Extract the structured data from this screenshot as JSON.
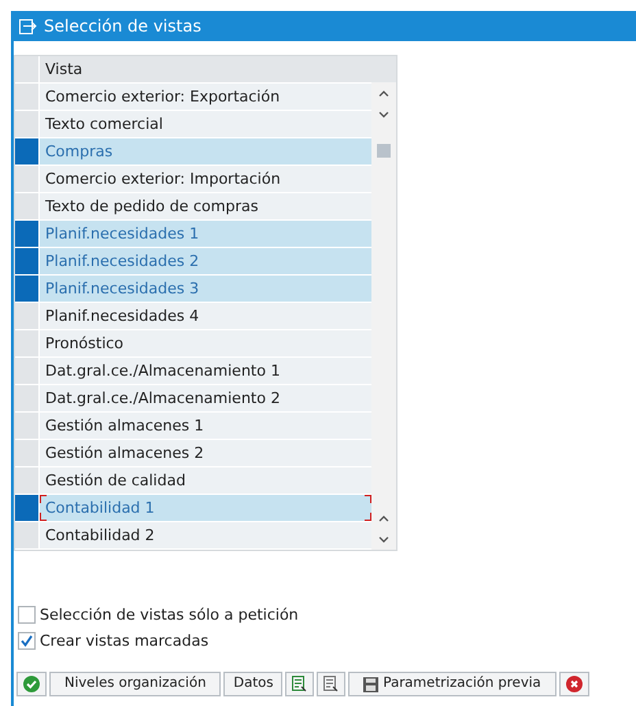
{
  "window": {
    "title": "Selección de vistas"
  },
  "table": {
    "columns": [
      "Vista"
    ],
    "rows": [
      {
        "label": "Comercio exterior: Exportación",
        "selected": false,
        "focused": false
      },
      {
        "label": "Texto comercial",
        "selected": false,
        "focused": false
      },
      {
        "label": "Compras",
        "selected": true,
        "focused": false
      },
      {
        "label": "Comercio exterior: Importación",
        "selected": false,
        "focused": false
      },
      {
        "label": "Texto de pedido de compras",
        "selected": false,
        "focused": false
      },
      {
        "label": "Planif.necesidades 1",
        "selected": true,
        "focused": false
      },
      {
        "label": "Planif.necesidades 2",
        "selected": true,
        "focused": false
      },
      {
        "label": "Planif.necesidades 3",
        "selected": true,
        "focused": false
      },
      {
        "label": "Planif.necesidades 4",
        "selected": false,
        "focused": false
      },
      {
        "label": "Pronóstico",
        "selected": false,
        "focused": false
      },
      {
        "label": "Dat.gral.ce./Almacenamiento 1",
        "selected": false,
        "focused": false
      },
      {
        "label": "Dat.gral.ce./Almacenamiento 2",
        "selected": false,
        "focused": false
      },
      {
        "label": "Gestión almacenes 1",
        "selected": false,
        "focused": false
      },
      {
        "label": "Gestión almacenes 2",
        "selected": false,
        "focused": false
      },
      {
        "label": "Gestión de calidad",
        "selected": false,
        "focused": false
      },
      {
        "label": "Contabilidad 1",
        "selected": true,
        "focused": true
      },
      {
        "label": "Contabilidad 2",
        "selected": false,
        "focused": false
      }
    ]
  },
  "options": [
    {
      "label": "Selección de vistas sólo a petición",
      "checked": false
    },
    {
      "label": "Crear vistas marcadas",
      "checked": true
    }
  ],
  "buttons": [
    {
      "kind": "ok"
    },
    {
      "kind": "text",
      "label": "Niveles organización"
    },
    {
      "kind": "text",
      "label": "Datos"
    },
    {
      "kind": "select-all"
    },
    {
      "kind": "deselect-all"
    },
    {
      "kind": "save",
      "label": "Parametrización previa"
    },
    {
      "kind": "cancel"
    }
  ]
}
